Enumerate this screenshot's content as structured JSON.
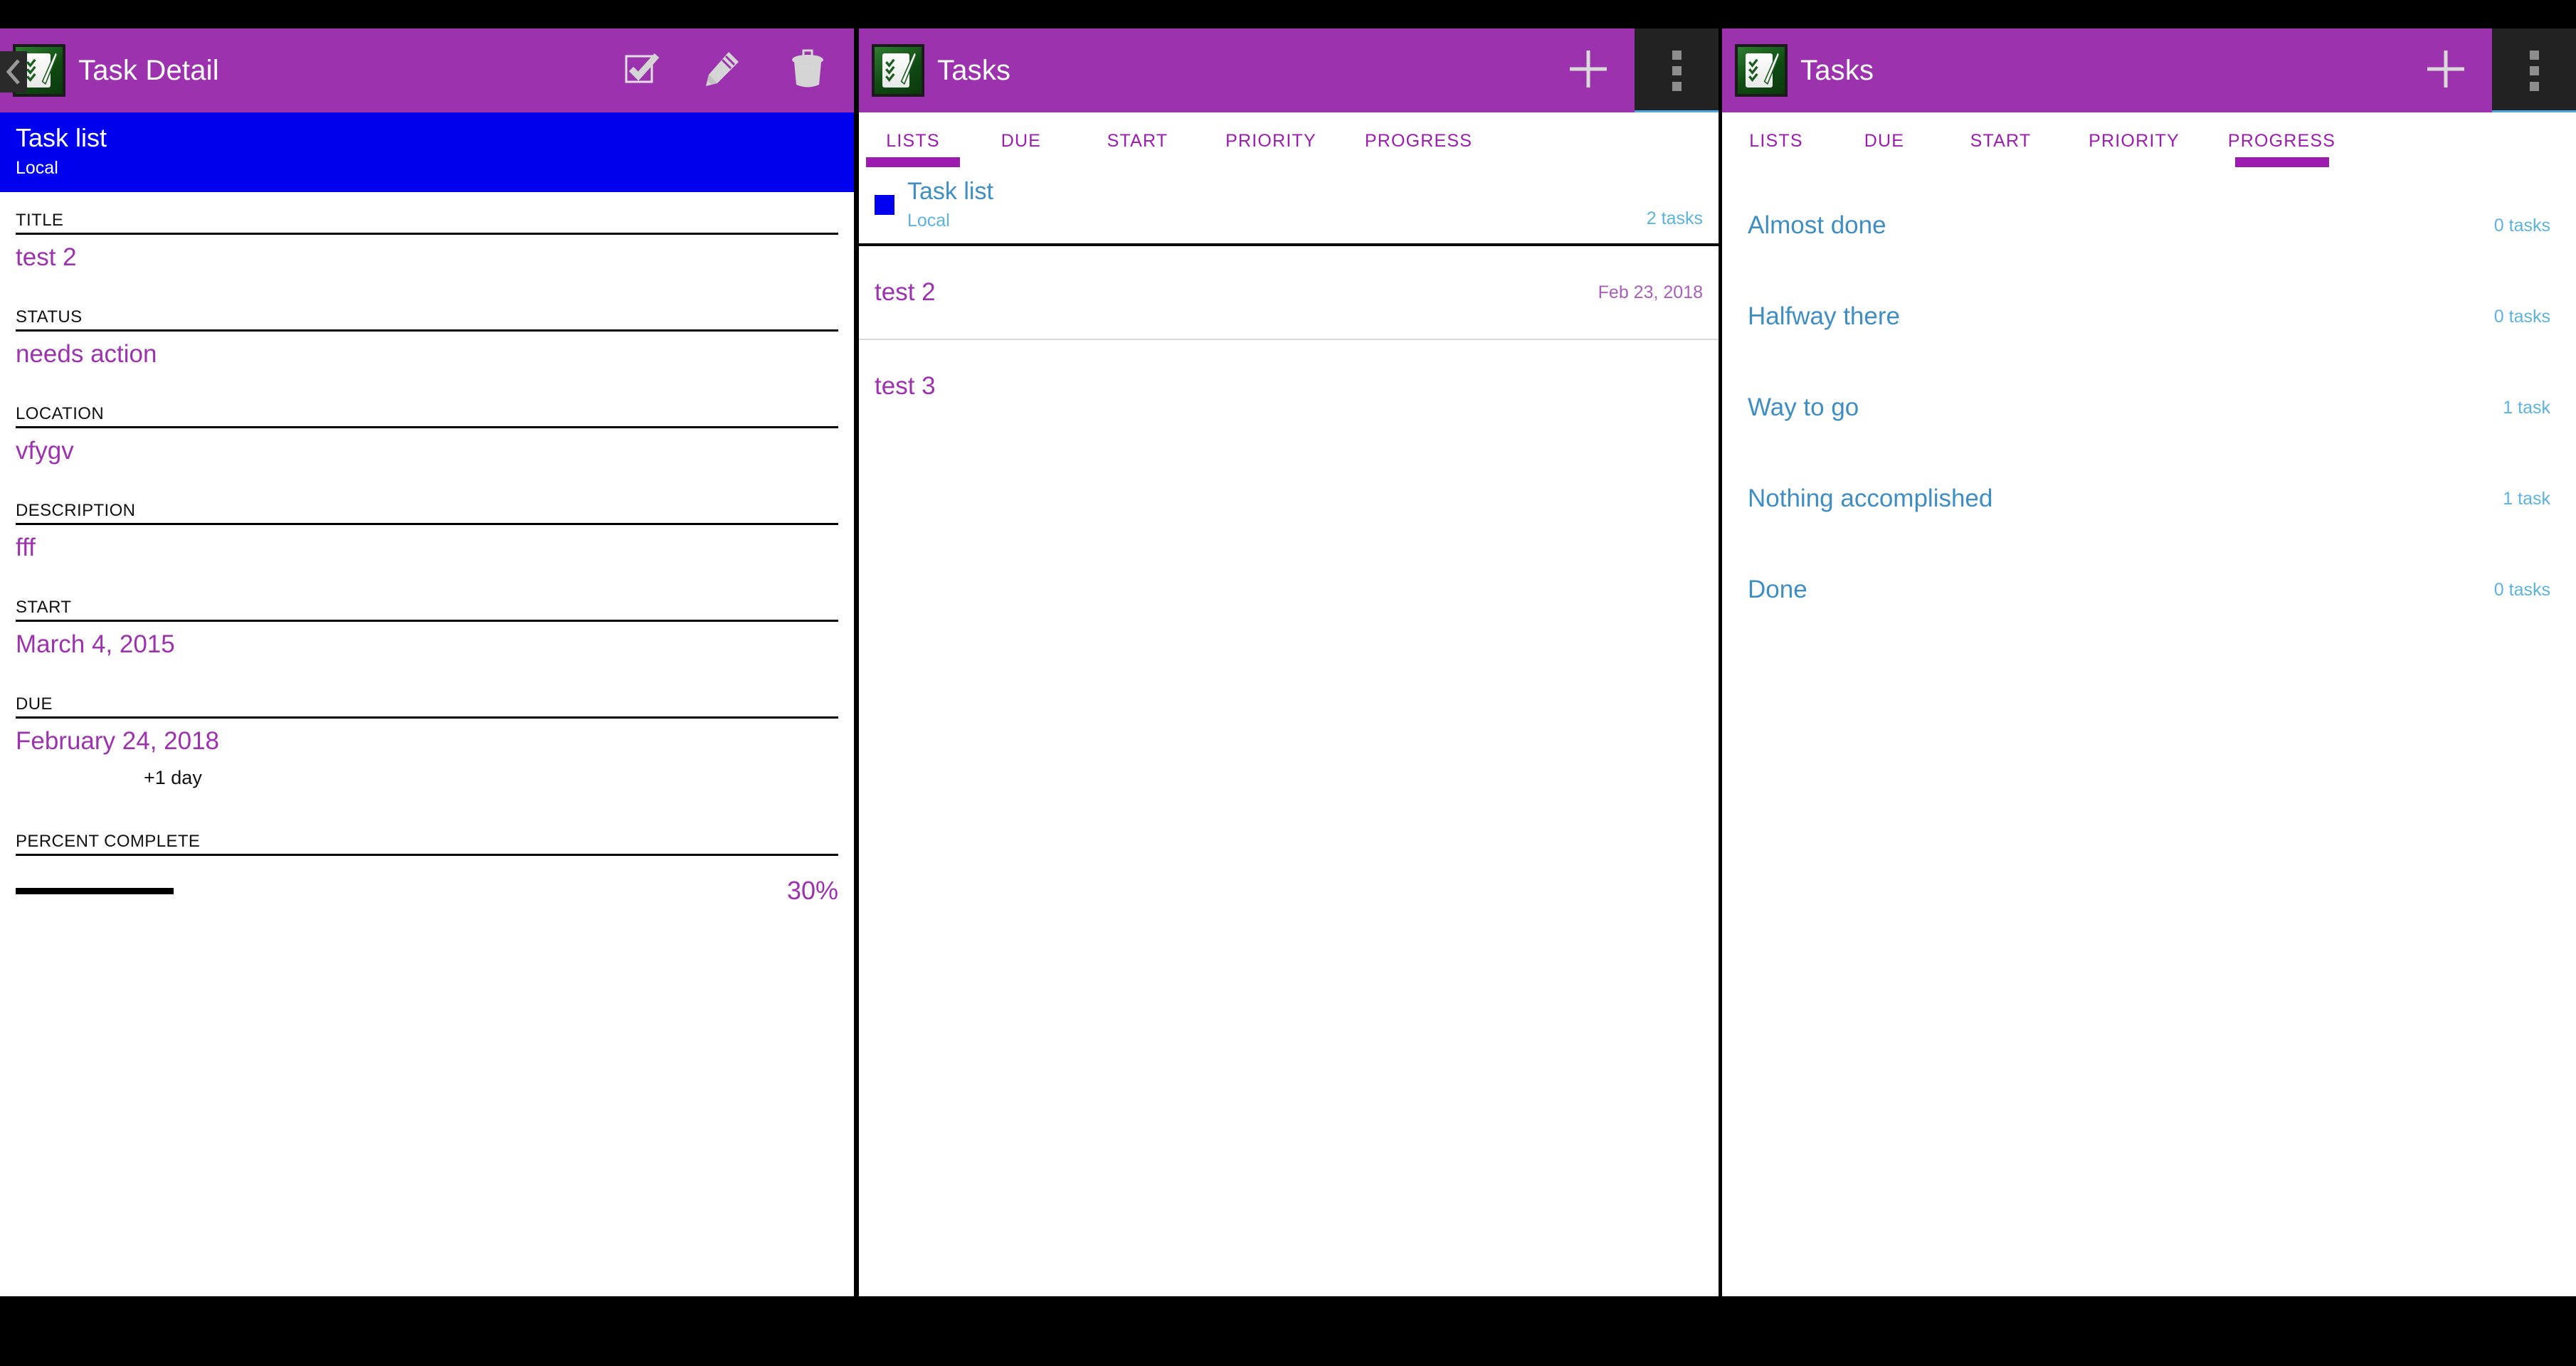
{
  "theme": {
    "appbar_purple": "#9c32ad",
    "accent_purple": "#9c1cb0",
    "value_purple": "#9c32ad",
    "list_blue": "#0000ee",
    "link_blue": "#3e8ec4",
    "muted_blue": "#5bb3e0",
    "overflow_dark": "#222222",
    "page_background": "#000000"
  },
  "panels": {
    "detail": {
      "appbar": {
        "title": "Task Detail",
        "app_icon": "checklist-pencil-icon",
        "back": "back-chevron-icon",
        "actions": [
          {
            "name": "complete-task-button",
            "icon": "checkbox-checked-icon"
          },
          {
            "name": "edit-task-button",
            "icon": "pencil-icon"
          },
          {
            "name": "delete-task-button",
            "icon": "trash-icon"
          }
        ]
      },
      "banner": {
        "list_name": "Task list",
        "account": "Local"
      },
      "fields": [
        {
          "label": "TITLE",
          "value": "test 2"
        },
        {
          "label": "STATUS",
          "value": "needs action"
        },
        {
          "label": "LOCATION",
          "value": "vfygv"
        },
        {
          "label": "DESCRIPTION",
          "value": "fff"
        },
        {
          "label": "START",
          "value": "March 4, 2015"
        },
        {
          "label": "DUE",
          "value": "February 24, 2018",
          "sub": "+1 day"
        }
      ],
      "percent_complete": {
        "label": "PERCENT COMPLETE",
        "percent_text": "30%",
        "percent_value": 30
      }
    },
    "lists": {
      "appbar": {
        "title": "Tasks",
        "app_icon": "checklist-pencil-icon",
        "add": {
          "name": "add-task-button",
          "icon": "plus-icon"
        },
        "overflow": {
          "name": "overflow-menu-button",
          "icon": "more-vertical-icon"
        }
      },
      "tabs": [
        {
          "label": "LISTS",
          "active": true
        },
        {
          "label": "DUE",
          "active": false
        },
        {
          "label": "START",
          "active": false
        },
        {
          "label": "PRIORITY",
          "active": false
        },
        {
          "label": "PROGRESS",
          "active": false
        }
      ],
      "list_header": {
        "swatch_color": "#0000ee",
        "title": "Task list",
        "account": "Local",
        "count": "2 tasks"
      },
      "tasks": [
        {
          "title": "test 2",
          "date": "Feb 23, 2018"
        },
        {
          "title": "test 3",
          "date": ""
        }
      ]
    },
    "progress": {
      "appbar": {
        "title": "Tasks",
        "app_icon": "checklist-pencil-icon",
        "add": {
          "name": "add-task-button",
          "icon": "plus-icon"
        },
        "overflow": {
          "name": "overflow-menu-button",
          "icon": "more-vertical-icon"
        }
      },
      "tabs": [
        {
          "label": "LISTS",
          "active": false
        },
        {
          "label": "DUE",
          "active": false
        },
        {
          "label": "START",
          "active": false
        },
        {
          "label": "PRIORITY",
          "active": false
        },
        {
          "label": "PROGRESS",
          "active": true
        }
      ],
      "buckets": [
        {
          "label": "Almost done",
          "count": "0 tasks"
        },
        {
          "label": "Halfway there",
          "count": "0 tasks"
        },
        {
          "label": "Way to go",
          "count": "1 task"
        },
        {
          "label": "Nothing accomplished",
          "count": "1 task"
        },
        {
          "label": "Done",
          "count": "0 tasks"
        }
      ]
    }
  }
}
